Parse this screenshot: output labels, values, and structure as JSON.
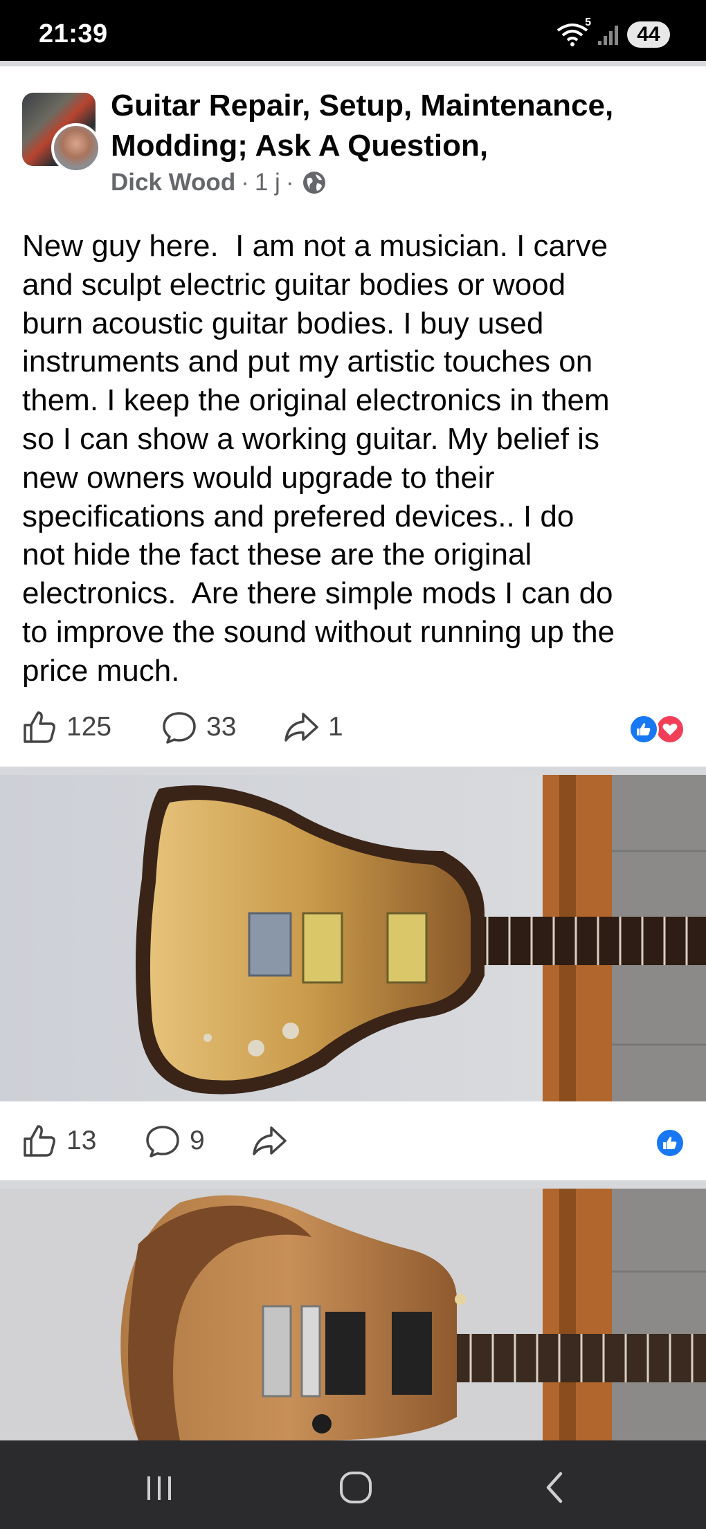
{
  "status_bar": {
    "time": "21:39",
    "network_badge": "5",
    "battery": "44",
    "icons": [
      "wifi-icon",
      "signal-icon",
      "battery-icon"
    ]
  },
  "post": {
    "group_name": "Guitar Repair, Setup, Maintenance, Modding; Ask A Question,",
    "author": "Dick Wood",
    "time": "1 j",
    "separator": "·",
    "privacy_icon": "globe-icon",
    "text": "New guy here.  I am not a musician. I carve\nand sculpt electric guitar bodies or wood\nburn acoustic guitar bodies. I buy used\ninstruments and put my artistic touches on\nthem. I keep the original electronics in them\nso I can show a working guitar. My belief is\nnew owners would upgrade to their\nspecifications and prefered devices.. I do\nnot hide the fact these are the original\nelectronics.  Are there simple mods I can do\nto improve the sound without running up the\nprice much.",
    "likes": "125",
    "comments": "33",
    "shares": "1",
    "reactions": [
      "like",
      "love"
    ]
  },
  "photos": [
    {
      "likes": "13",
      "comments": "9",
      "shares": "",
      "reactions": [
        "like"
      ]
    }
  ],
  "colors": {
    "like_blue": "#1877f2",
    "love_red": "#f33e58",
    "meta_gray": "#65676b",
    "separator": "#d6d8dc",
    "nav_bar": "#2b2b2d"
  },
  "nav_bar": {
    "buttons": [
      "recents-icon",
      "home-icon",
      "back-icon"
    ]
  }
}
